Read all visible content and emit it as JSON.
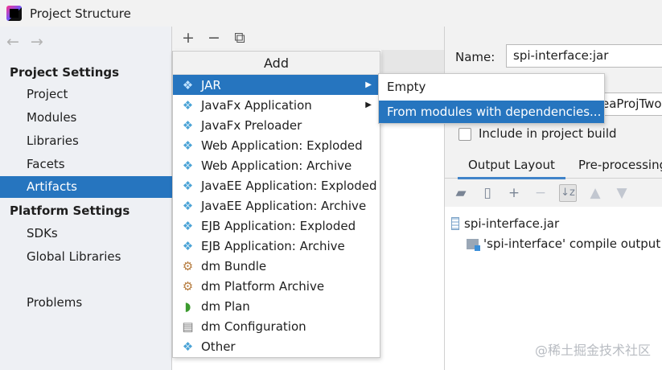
{
  "window": {
    "title": "Project Structure"
  },
  "nav": {
    "back": "←",
    "forward": "→"
  },
  "sidebar": {
    "project_settings_header": "Project Settings",
    "project_items": [
      {
        "label": "Project"
      },
      {
        "label": "Modules"
      },
      {
        "label": "Libraries"
      },
      {
        "label": "Facets"
      },
      {
        "label": "Artifacts",
        "selected": true
      }
    ],
    "platform_settings_header": "Platform Settings",
    "platform_items": [
      {
        "label": "SDKs"
      },
      {
        "label": "Global Libraries"
      }
    ],
    "problems": "Problems"
  },
  "toolbar": {
    "add": "+",
    "remove": "−",
    "copy": "⧉"
  },
  "add_menu": {
    "title": "Add",
    "items": [
      {
        "label": "JAR",
        "icon": "jar-icon",
        "glyph": "❖",
        "has_submenu": true,
        "selected": true
      },
      {
        "label": "JavaFx Application",
        "icon": "javafx-icon",
        "glyph": "❖",
        "has_submenu": true
      },
      {
        "label": "JavaFx Preloader",
        "icon": "javafx-icon",
        "glyph": "❖"
      },
      {
        "label": "Web Application: Exploded",
        "icon": "web-app-icon",
        "glyph": "❖"
      },
      {
        "label": "Web Application: Archive",
        "icon": "web-app-icon",
        "glyph": "❖"
      },
      {
        "label": "JavaEE Application: Exploded",
        "icon": "javaee-icon",
        "glyph": "❖"
      },
      {
        "label": "JavaEE Application: Archive",
        "icon": "javaee-icon",
        "glyph": "❖"
      },
      {
        "label": "EJB Application: Exploded",
        "icon": "ejb-icon",
        "glyph": "❖"
      },
      {
        "label": "EJB Application: Archive",
        "icon": "ejb-icon",
        "glyph": "❖"
      },
      {
        "label": "dm Bundle",
        "icon": "dm-bundle-icon",
        "glyph": "⚙"
      },
      {
        "label": "dm Platform Archive",
        "icon": "dm-platform-icon",
        "glyph": "⚙"
      },
      {
        "label": "dm Plan",
        "icon": "dm-plan-icon",
        "glyph": "◗"
      },
      {
        "label": "dm Configuration",
        "icon": "dm-config-icon",
        "glyph": "▤"
      },
      {
        "label": "Other",
        "icon": "other-icon",
        "glyph": "❖"
      }
    ],
    "submenu_arrow": "▶"
  },
  "jar_submenu": {
    "items": [
      {
        "label": "Empty"
      },
      {
        "label": "From modules with dependencies...",
        "selected": true
      }
    ]
  },
  "details": {
    "name_label": "Name:",
    "name_value": "spi-interface:jar",
    "output_dir_value": "eaProjTwo",
    "include_build_label": "Include in project build",
    "include_build_checked": false,
    "tabs": [
      {
        "label": "Output Layout",
        "active": true
      },
      {
        "label": "Pre-processing"
      }
    ],
    "output_toolbar": {
      "new_dir": "▰",
      "archive": "▯",
      "add": "+",
      "remove": "−",
      "sort": "↓z",
      "up": "▲",
      "down": "▼"
    },
    "tree": [
      {
        "label": "spi-interface.jar",
        "icon": "jar-icon"
      },
      {
        "label": "'spi-interface' compile output",
        "icon": "module-output-icon"
      }
    ]
  },
  "watermark": "@稀土掘金技术社区",
  "colors": {
    "selection": "#2675bf",
    "menu_icon": "#4aa3d6"
  }
}
